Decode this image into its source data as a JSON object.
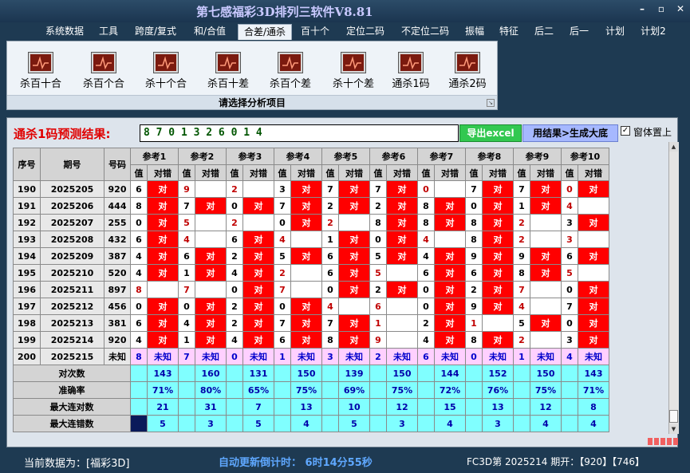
{
  "app": {
    "title": "第七感福彩3D排列三软件V8.81"
  },
  "menu": [
    "系统数据",
    "工具",
    "跨度/复式",
    "和/合值",
    "合差/通杀",
    "百十个",
    "定位二码",
    "不定位二码",
    "振幅",
    "特征",
    "后二",
    "后一",
    "计划",
    "计划2"
  ],
  "active_menu": "合差/通杀",
  "tools": [
    "杀百十合",
    "杀百个合",
    "杀十个合",
    "杀百十差",
    "杀百个差",
    "杀十个差",
    "通杀1码",
    "通杀2码"
  ],
  "panel_caption": "请选择分析项目",
  "prediction": {
    "label": "通杀1码预测结果:",
    "value": "8 7 0 1 3 2 6 0 1 4",
    "export_label": "导出excel",
    "generate_label": "用结果>生成大底",
    "topmost_label": "窗体置上",
    "topmost_check": "✓"
  },
  "table": {
    "col_seq": "序号",
    "col_issue": "期号",
    "col_num": "号码",
    "refs": [
      "参考1",
      "参考2",
      "参考3",
      "参考4",
      "参考5",
      "参考6",
      "参考7",
      "参考8",
      "参考9",
      "参考10"
    ],
    "sub_value": "值",
    "sub_result": "对错",
    "hit_text": "对",
    "rows": [
      {
        "seq": "190",
        "issue": "2025205",
        "num": "920",
        "vals": [
          "6",
          "9",
          "2",
          "3",
          "7",
          "7",
          "0",
          "7",
          "7",
          "0"
        ],
        "hits": [
          1,
          0,
          0,
          1,
          1,
          1,
          0,
          1,
          1,
          1
        ],
        "red": [
          0,
          1,
          1,
          0,
          0,
          0,
          1,
          0,
          0,
          1
        ]
      },
      {
        "seq": "191",
        "issue": "2025206",
        "num": "444",
        "vals": [
          "8",
          "7",
          "0",
          "7",
          "2",
          "2",
          "8",
          "0",
          "1",
          "4"
        ],
        "hits": [
          1,
          1,
          1,
          1,
          1,
          1,
          1,
          1,
          1,
          0
        ],
        "red": [
          0,
          0,
          0,
          0,
          0,
          0,
          0,
          0,
          0,
          1
        ]
      },
      {
        "seq": "192",
        "issue": "2025207",
        "num": "255",
        "vals": [
          "0",
          "5",
          "2",
          "0",
          "2",
          "8",
          "8",
          "8",
          "2",
          "3"
        ],
        "hits": [
          1,
          0,
          0,
          1,
          0,
          1,
          1,
          1,
          0,
          1
        ],
        "red": [
          0,
          1,
          1,
          0,
          1,
          0,
          0,
          0,
          1,
          0
        ]
      },
      {
        "seq": "193",
        "issue": "2025208",
        "num": "432",
        "vals": [
          "6",
          "4",
          "6",
          "4",
          "1",
          "0",
          "4",
          "8",
          "2",
          "3"
        ],
        "hits": [
          1,
          0,
          1,
          0,
          1,
          1,
          0,
          1,
          0,
          0
        ],
        "red": [
          0,
          1,
          0,
          1,
          0,
          0,
          1,
          0,
          1,
          1
        ]
      },
      {
        "seq": "194",
        "issue": "2025209",
        "num": "387",
        "vals": [
          "4",
          "6",
          "2",
          "5",
          "6",
          "5",
          "4",
          "9",
          "9",
          "6"
        ],
        "hits": [
          1,
          1,
          1,
          1,
          1,
          1,
          1,
          1,
          1,
          1
        ],
        "red": [
          0,
          0,
          0,
          0,
          0,
          0,
          0,
          0,
          0,
          0
        ]
      },
      {
        "seq": "195",
        "issue": "2025210",
        "num": "520",
        "vals": [
          "4",
          "1",
          "4",
          "2",
          "6",
          "5",
          "6",
          "6",
          "8",
          "5"
        ],
        "hits": [
          1,
          1,
          1,
          0,
          1,
          0,
          1,
          1,
          1,
          0
        ],
        "red": [
          0,
          0,
          0,
          1,
          0,
          1,
          0,
          0,
          0,
          1
        ]
      },
      {
        "seq": "196",
        "issue": "2025211",
        "num": "897",
        "vals": [
          "8",
          "7",
          "0",
          "7",
          "0",
          "2",
          "0",
          "2",
          "7",
          "0"
        ],
        "hits": [
          0,
          0,
          1,
          0,
          1,
          1,
          1,
          1,
          0,
          1
        ],
        "red": [
          1,
          1,
          0,
          1,
          0,
          0,
          0,
          0,
          1,
          0
        ]
      },
      {
        "seq": "197",
        "issue": "2025212",
        "num": "456",
        "vals": [
          "0",
          "0",
          "2",
          "0",
          "4",
          "6",
          "0",
          "9",
          "4",
          "7"
        ],
        "hits": [
          1,
          1,
          1,
          1,
          0,
          0,
          1,
          1,
          0,
          1
        ],
        "red": [
          0,
          0,
          0,
          0,
          1,
          1,
          0,
          0,
          1,
          0
        ]
      },
      {
        "seq": "198",
        "issue": "2025213",
        "num": "381",
        "vals": [
          "6",
          "4",
          "2",
          "7",
          "7",
          "1",
          "2",
          "1",
          "5",
          "0"
        ],
        "hits": [
          1,
          1,
          1,
          1,
          1,
          0,
          1,
          0,
          1,
          1
        ],
        "red": [
          0,
          0,
          0,
          0,
          0,
          1,
          0,
          1,
          0,
          0
        ]
      },
      {
        "seq": "199",
        "issue": "2025214",
        "num": "920",
        "vals": [
          "4",
          "1",
          "4",
          "6",
          "8",
          "9",
          "4",
          "8",
          "2",
          "3"
        ],
        "hits": [
          1,
          1,
          1,
          1,
          1,
          0,
          1,
          1,
          0,
          1
        ],
        "red": [
          0,
          0,
          0,
          0,
          0,
          1,
          0,
          0,
          1,
          0
        ]
      }
    ],
    "unknown_row": {
      "seq": "200",
      "issue": "2025215",
      "num": "未知",
      "vals": [
        "8",
        "7",
        "0",
        "1",
        "3",
        "2",
        "6",
        "0",
        "1",
        "4"
      ],
      "result": "未知"
    },
    "stats": [
      {
        "label": "对次数",
        "vals": [
          "143",
          "160",
          "131",
          "150",
          "139",
          "150",
          "144",
          "152",
          "150",
          "143"
        ]
      },
      {
        "label": "准确率",
        "vals": [
          "71%",
          "80%",
          "65%",
          "75%",
          "69%",
          "75%",
          "72%",
          "76%",
          "75%",
          "71%"
        ]
      },
      {
        "label": "最大连对数",
        "vals": [
          "21",
          "31",
          "7",
          "13",
          "10",
          "12",
          "15",
          "13",
          "12",
          "8"
        ]
      },
      {
        "label": "最大连错数",
        "vals": [
          "5",
          "3",
          "5",
          "4",
          "5",
          "3",
          "4",
          "3",
          "4",
          "4"
        ]
      }
    ]
  },
  "status": {
    "data_source": "当前数据为：[福彩3D]",
    "countdown": "自动更新倒计时： 6时14分55秒",
    "issue_info": "FC3D第 2025214 期开：【920】【746】"
  }
}
